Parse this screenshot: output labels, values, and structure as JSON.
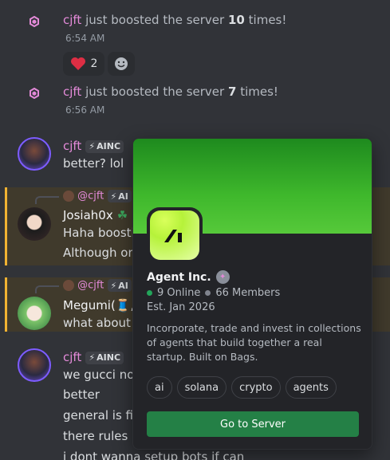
{
  "messages": [
    {
      "user": "cjft",
      "pre": "just boosted the server",
      "count": "10",
      "post": "times!",
      "time": "6:54 AM"
    },
    {
      "user": "cjft",
      "pre": "just boosted the server",
      "count": "7",
      "post": "times!",
      "time": "6:56 AM"
    }
  ],
  "reactions": [
    {
      "emoji": "❤️",
      "count": "2"
    }
  ],
  "chat": {
    "m1": {
      "user": "cjft",
      "tag": "AINC",
      "text": "better? lol"
    },
    "r1": {
      "reply_user": "@cjft",
      "reply_tag": "AI",
      "user": "Josiah0x",
      "line1": "Haha boostin",
      "line2": "Although onl"
    },
    "r2": {
      "reply_user": "@cjft",
      "reply_tag": "AI",
      "user": "Megumi(🧵,",
      "line1": "what about a"
    },
    "m2": {
      "user": "cjft",
      "tag": "AINC",
      "lines": [
        "we gucci now",
        "better",
        "general is fine",
        "there rules n",
        "i dont wanna setup bots if can"
      ]
    }
  },
  "server": {
    "name": "Agent Inc.",
    "online": "9 Online",
    "members": "66 Members",
    "est": "Est. Jan 2026",
    "description": "Incorporate, trade and invest in collections of agents that build together a real startup. Built on Bags.",
    "tags": [
      "ai",
      "solana",
      "crypto",
      "agents"
    ],
    "button": "Go to Server",
    "colors": {
      "online": "#23a55a",
      "members": "#80848e",
      "button": "#248046",
      "banner": "#3fb82c"
    }
  }
}
